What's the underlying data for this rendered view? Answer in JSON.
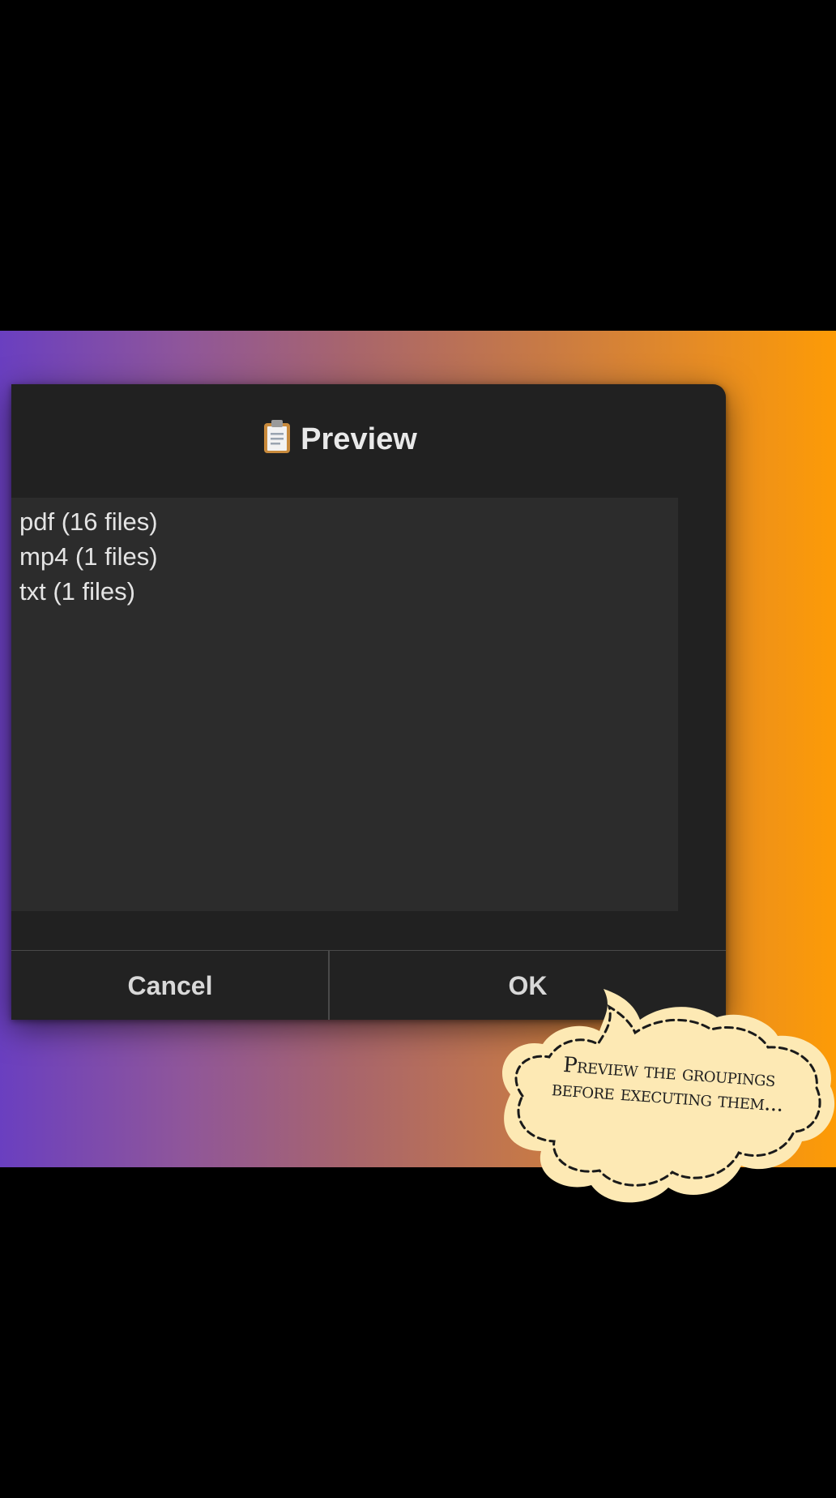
{
  "dialog": {
    "title": "Preview",
    "title_icon": "clipboard-icon",
    "items": [
      "pdf (16 files)",
      "mp4 (1 files)",
      "txt (1 files)"
    ],
    "buttons": {
      "cancel": "Cancel",
      "ok": "OK"
    }
  },
  "callout": {
    "text": "Preview the groupings before executing them..."
  },
  "colors": {
    "background": "#000000",
    "gradient_start": "#6a3fc0",
    "gradient_end": "#fd9b06",
    "dialog_bg": "#212121",
    "list_bg": "#2c2c2c",
    "text": "#e4e4e4",
    "callout_fill": "#fde9b4"
  }
}
